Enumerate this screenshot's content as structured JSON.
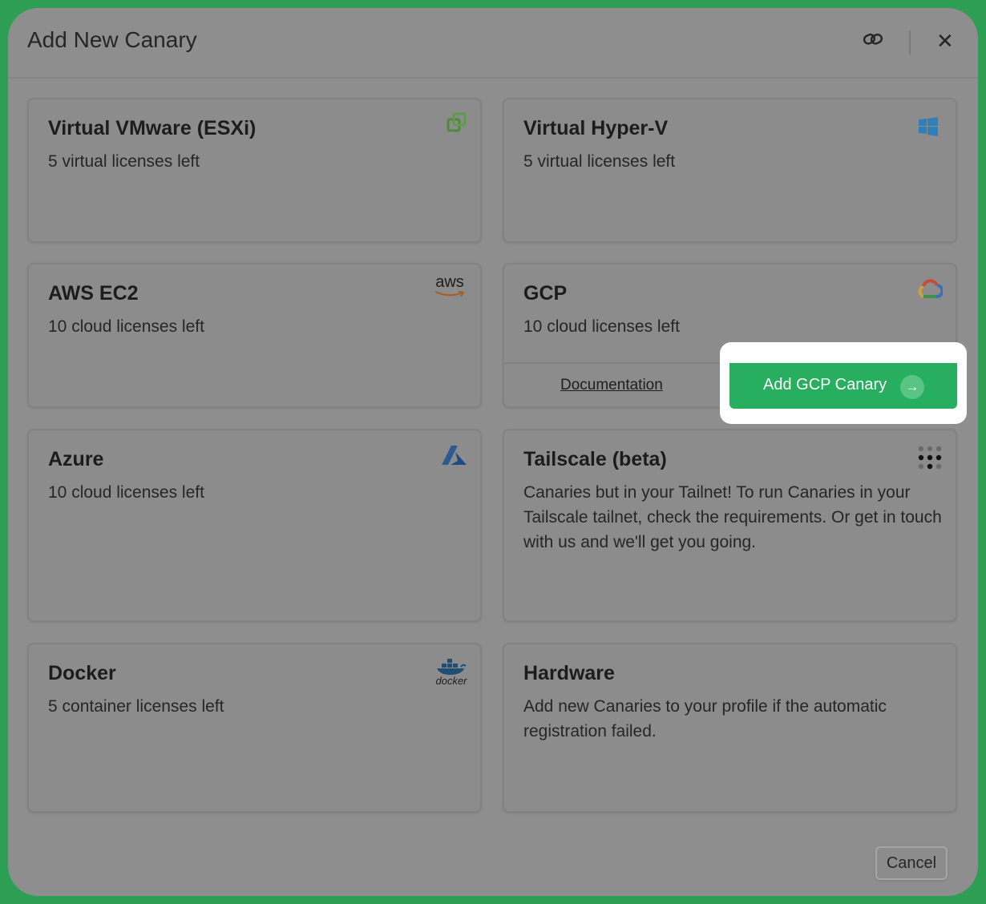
{
  "dialog": {
    "title": "Add New Canary",
    "cancel_label": "Cancel"
  },
  "header_icons": [
    "link-icon",
    "close-icon"
  ],
  "cards": {
    "vmware": {
      "title": "Virtual VMware (ESXi)",
      "subtitle": "5 virtual licenses left",
      "icon": "vmware-icon"
    },
    "hyperv": {
      "title": "Virtual Hyper-V",
      "subtitle": "5 virtual licenses left",
      "icon": "windows-icon"
    },
    "aws": {
      "title": "AWS EC2",
      "subtitle": "10 cloud licenses left",
      "icon": "aws-icon",
      "icon_text": "aws"
    },
    "gcp": {
      "title": "GCP",
      "subtitle": "10 cloud licenses left",
      "icon": "google-cloud-icon",
      "doc_label": "Documentation",
      "add_label": "Add GCP Canary"
    },
    "azure": {
      "title": "Azure",
      "subtitle": "10 cloud licenses left",
      "icon": "azure-icon"
    },
    "tailscale": {
      "title": "Tailscale (beta)",
      "subtitle": "Canaries but in your Tailnet! To run Canaries in your Tailscale tailnet, check the requirements. Or get in touch with us and we'll get you going.",
      "icon": "tailscale-icon"
    },
    "docker": {
      "title": "Docker",
      "subtitle": "5 container licenses left",
      "icon": "docker-icon",
      "icon_text": "docker"
    },
    "hardware": {
      "title": "Hardware",
      "subtitle": "Add new Canaries to your profile if the automatic registration failed."
    }
  },
  "colors": {
    "accent": "#27ae5f",
    "frame": "#2f9e55",
    "overlay": "#8e8e8e"
  }
}
